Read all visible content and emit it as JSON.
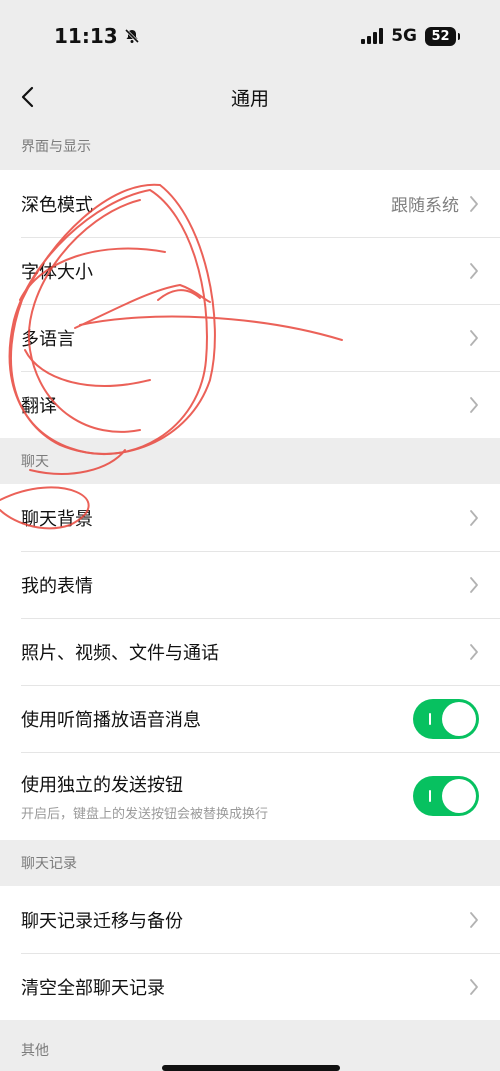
{
  "status_bar": {
    "time": "11:13",
    "network": "5G",
    "battery": "52"
  },
  "nav": {
    "title": "通用"
  },
  "sections": {
    "display": {
      "header": "界面与显示",
      "items": [
        {
          "label": "深色模式",
          "value": "跟随系统"
        },
        {
          "label": "字体大小"
        },
        {
          "label": "多语言"
        },
        {
          "label": "翻译"
        }
      ]
    },
    "chat": {
      "header": "聊天",
      "items": [
        {
          "label": "聊天背景"
        },
        {
          "label": "我的表情"
        },
        {
          "label": "照片、视频、文件与通话"
        },
        {
          "label": "使用听筒播放语音消息",
          "toggle": true
        },
        {
          "label": "使用独立的发送按钮",
          "sub": "开启后，键盘上的发送按钮会被替换成换行",
          "toggle": true
        }
      ]
    },
    "history": {
      "header": "聊天记录",
      "items": [
        {
          "label": "聊天记录迁移与备份"
        },
        {
          "label": "清空全部聊天记录"
        }
      ]
    },
    "other": {
      "header": "其他"
    }
  },
  "colors": {
    "accent": "#07c160",
    "annotation": "#e8463c",
    "background": "#ededed"
  }
}
